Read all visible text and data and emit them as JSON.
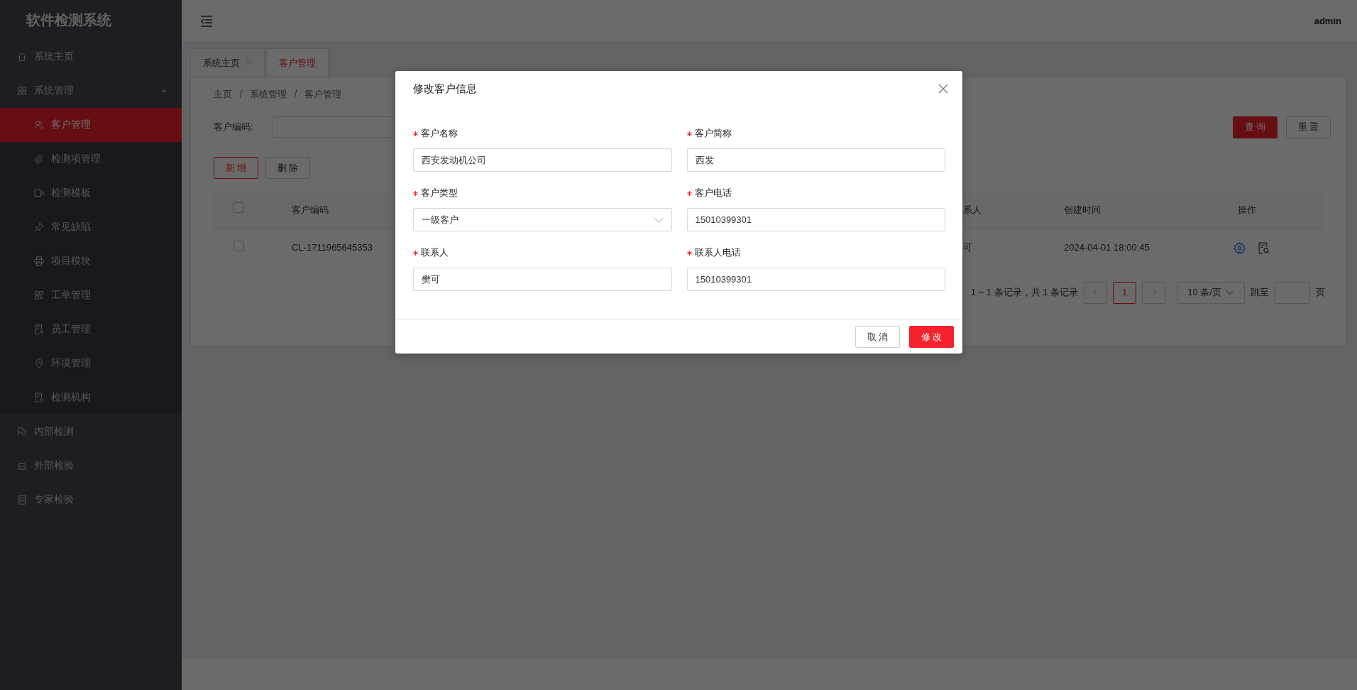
{
  "sidebar": {
    "title": "软件检测系统",
    "items": [
      {
        "label": "系统主页",
        "selected": false
      },
      {
        "label": "系统管理",
        "selected": false,
        "expanded": true,
        "children": [
          {
            "label": "客户管理",
            "selected": true
          },
          {
            "label": "检测项管理",
            "selected": false
          },
          {
            "label": "检测模板",
            "selected": false
          },
          {
            "label": "常见缺陷",
            "selected": false
          },
          {
            "label": "项目模块",
            "selected": false
          },
          {
            "label": "工单管理",
            "selected": false
          },
          {
            "label": "员工管理",
            "selected": false
          },
          {
            "label": "环境管理",
            "selected": false
          },
          {
            "label": "检测机构",
            "selected": false
          }
        ]
      },
      {
        "label": "内部检测",
        "selected": false
      },
      {
        "label": "外部检验",
        "selected": false
      },
      {
        "label": "专家检验",
        "selected": false
      }
    ]
  },
  "header": {
    "user": "admin"
  },
  "tabs": [
    {
      "label": "系统主页",
      "selected": false,
      "closable": true
    },
    {
      "label": "客户管理",
      "selected": true,
      "closable": false
    }
  ],
  "breadcrumb": [
    "主页",
    "系统管理",
    "客户管理"
  ],
  "search": {
    "label": "客户编码:",
    "buttons": [
      {
        "label": "查 询",
        "kind": "primary"
      },
      {
        "label": "重 置",
        "kind": "default"
      }
    ]
  },
  "toolbar": [
    {
      "label": "新 增",
      "kind": "outline"
    },
    {
      "label": "删 除",
      "kind": "default"
    }
  ],
  "table": {
    "select_all": {
      "checked": false
    },
    "columns": [
      "客户编码",
      "系人",
      "创建时间",
      "操作"
    ],
    "rows": [
      {
        "checked": false,
        "cells": [
          "CL-1711965645353",
          "可",
          "2024-04-01 18:00:45"
        ]
      }
    ]
  },
  "pagination": {
    "summary": "1 ~ 1 条记录，共 1 条记录",
    "pages": [
      {
        "label": "1",
        "selected": true
      }
    ],
    "page_size": "10 条/页",
    "jump_label": "跳至",
    "jump_unit": "页"
  },
  "dialog": {
    "title": "修改客户信息",
    "fields": [
      {
        "label": "客户名称",
        "required": true,
        "kind": "text",
        "value": "西安发动机公司"
      },
      {
        "label": "客户简称",
        "required": true,
        "kind": "text",
        "value": "西发"
      },
      {
        "label": "客户类型",
        "required": true,
        "kind": "select",
        "value": "一级客户"
      },
      {
        "label": "客户电话",
        "required": true,
        "kind": "text",
        "value": "15010399301"
      },
      {
        "label": "联系人",
        "required": true,
        "kind": "text",
        "value": "樊可"
      },
      {
        "label": "联系人电话",
        "required": true,
        "kind": "text",
        "value": "15010399301"
      }
    ],
    "buttons": [
      {
        "label": "取 消",
        "kind": "default"
      },
      {
        "label": "修 改",
        "kind": "primary"
      }
    ]
  }
}
